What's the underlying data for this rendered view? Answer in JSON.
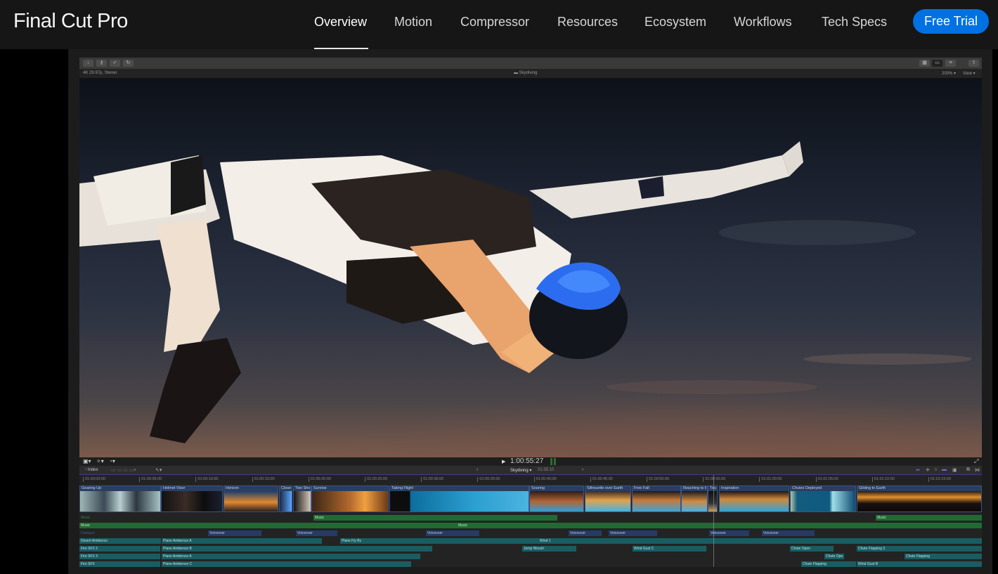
{
  "nav": {
    "brand": "Final Cut Pro",
    "links": [
      {
        "label": "Overview",
        "active": true
      },
      {
        "label": "Motion",
        "active": false
      },
      {
        "label": "Compressor",
        "active": false
      },
      {
        "label": "Resources",
        "active": false
      },
      {
        "label": "Ecosystem",
        "active": false
      },
      {
        "label": "Workflows",
        "active": false
      },
      {
        "label": "Tech Specs",
        "active": false
      }
    ],
    "cta": "Free Trial",
    "accent": "#0071e3"
  },
  "app": {
    "toolbar": {
      "left_icons": [
        "import-icon",
        "keyword-icon",
        "checkmark-icon",
        "background-tasks-icon"
      ],
      "right_icons": [
        "browser-layout-icon",
        "timeline-layout-icon",
        "inspector-layout-icon",
        "share-icon"
      ]
    },
    "viewer_info": {
      "format": "4K 29.97p, Stereo",
      "clip_name": "Skydiving",
      "zoom": "200%",
      "view": "View"
    },
    "viewer_controls": {
      "timecode": "1:00:55:27"
    },
    "timeline_header": {
      "index": "Index",
      "project": "Skydiving",
      "duration": "01:35:10"
    },
    "ruler": [
      "01:00:00:00",
      "01:00:05:00",
      "01:00:10:00",
      "01:00:15:00",
      "01:00:20:00",
      "01:00:25:00",
      "01:00:30:00",
      "01:00:35:00",
      "01:00:40:00",
      "01:00:45:00",
      "01:00:50:00",
      "01:00:55:00",
      "01:01:00:00",
      "01:01:05:00",
      "01:01:10:00",
      "01:01:15:00"
    ],
    "video_clips": [
      {
        "label": "Gearing Up"
      },
      {
        "label": "Helmet Visor"
      },
      {
        "label": "Horizon"
      },
      {
        "label": "Close..."
      },
      {
        "label": "Two Shot"
      },
      {
        "label": "Sunrise"
      },
      {
        "label": "Taking Flight"
      },
      {
        "label": "Soaring"
      },
      {
        "label": "Silhouette over Earth"
      },
      {
        "label": "Free Fall"
      },
      {
        "label": "Reaching to th..."
      },
      {
        "label": "Touc..."
      },
      {
        "label": "Inspiration"
      },
      {
        "label": "Chutes Deployed"
      },
      {
        "label": "Gliding to Earth"
      }
    ],
    "audio_rows": {
      "music_role": "Music",
      "dialogue_role": "Dialogue",
      "music_clips": [
        "Music",
        "Music",
        "Music",
        "Music"
      ],
      "voiceover": "Voiceover",
      "row_ambience": [
        "Desert Ambience",
        "Plane Ambience A",
        "Plane Fly By",
        "Wind 1"
      ],
      "row_sfx2": [
        "Fire SFX 2",
        "Plane Ambience B",
        "Jump Woosh",
        "Wind Gust C",
        "Chute Open",
        "Chute Flapping 3"
      ],
      "row_sfx3": [
        "Fire SFX 3",
        "Plane Ambience A",
        "Chute Ope...",
        "Chute Flapping"
      ],
      "row_sfx": [
        "Fire SFX",
        "Plane Ambience C",
        "Chute Flapping",
        "Wind Gust B"
      ]
    }
  }
}
